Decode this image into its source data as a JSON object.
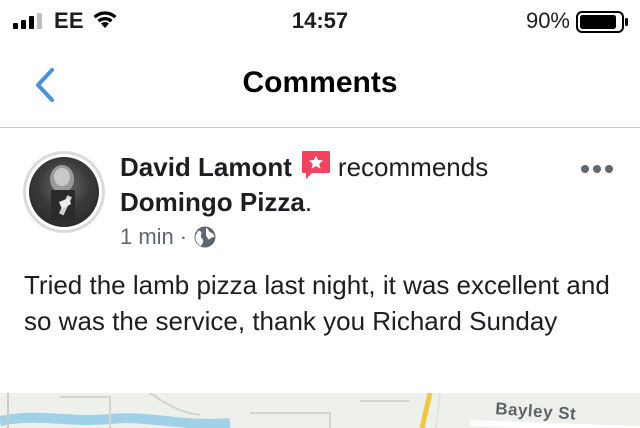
{
  "status_bar": {
    "carrier": "EE",
    "time": "14:57",
    "battery_percent": "90%",
    "battery_level": 0.9,
    "signal_bars": 3,
    "signal_icon": "cellular-signal-icon",
    "wifi_icon": "wifi-icon",
    "battery_icon": "battery-icon"
  },
  "nav": {
    "title": "Comments",
    "back_icon": "chevron-left-icon"
  },
  "post": {
    "author": "David Lamont",
    "recommend_icon": "recommend-star-icon",
    "action": "recommends",
    "page": "Domingo Pizza",
    "page_suffix": ".",
    "timestamp": "1 min",
    "separator": "·",
    "privacy_icon": "globe-icon",
    "more_icon": "more-dots-icon",
    "body": "Tried the lamb pizza last night, it was excellent and so was the service, thank you Richard Sunday"
  },
  "map": {
    "street_label": "Bayley St"
  },
  "colors": {
    "accent": "#4a90e2",
    "recommend": "#f3425f",
    "text_primary": "#1c1e21",
    "text_secondary": "#606770",
    "divider": "#c8c8cc"
  }
}
